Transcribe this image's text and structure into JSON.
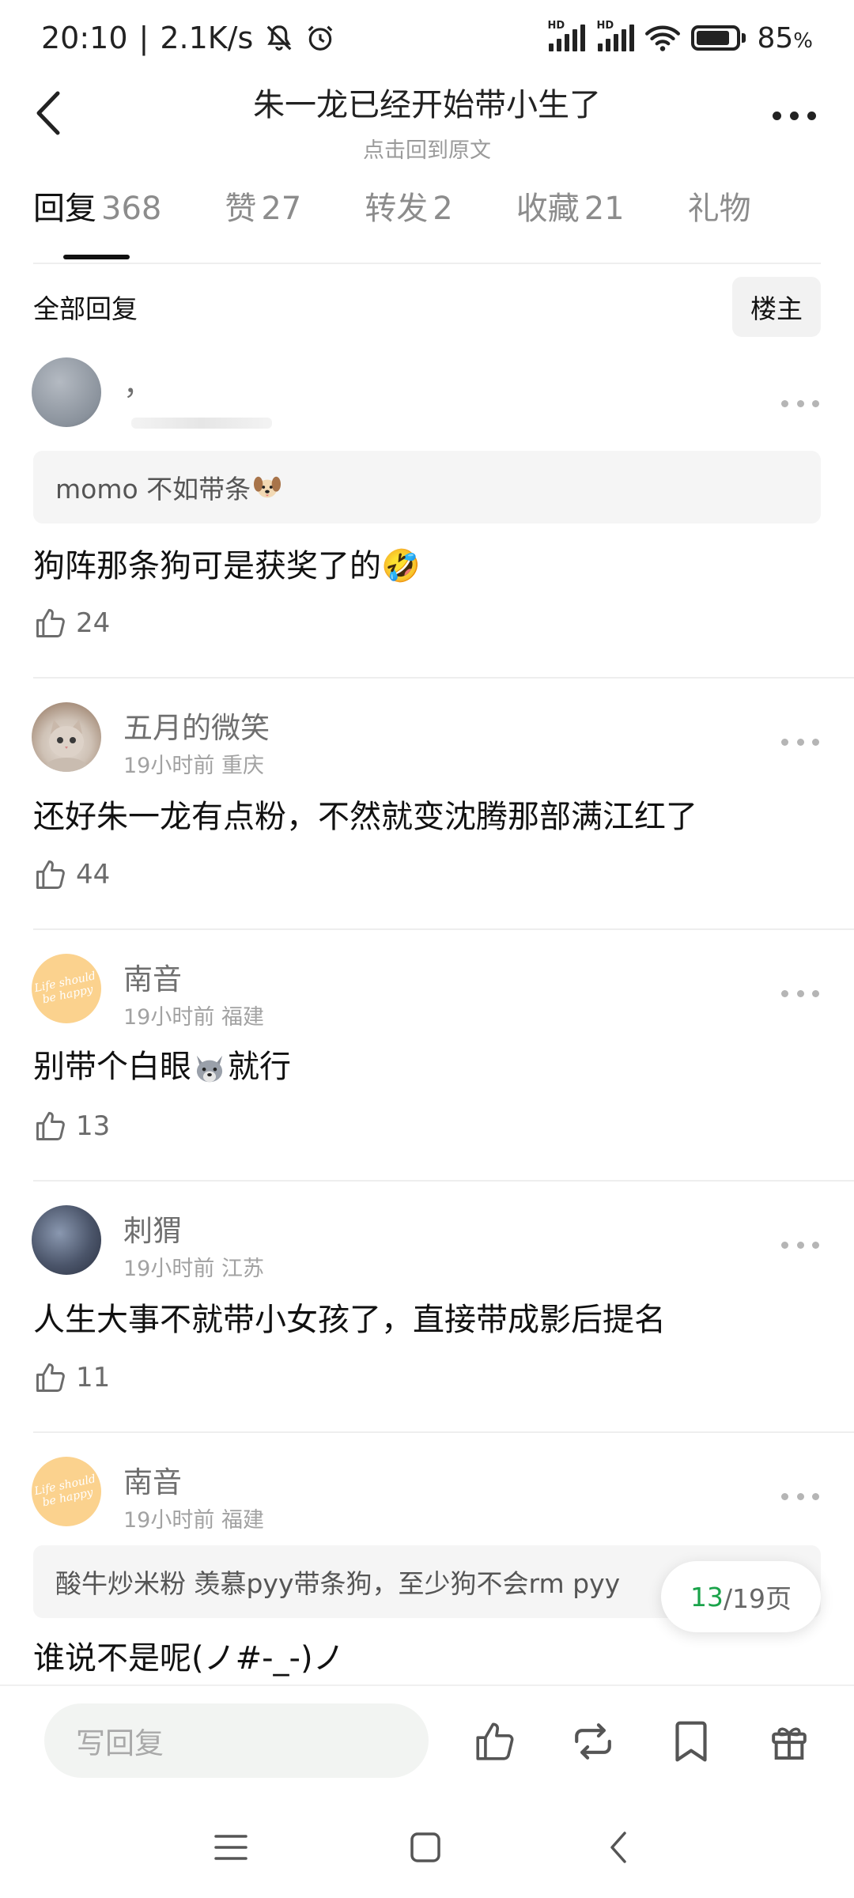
{
  "status": {
    "time": "20:10",
    "speed": "2.1K/s",
    "battery": "85",
    "battery_unit": "%",
    "battery_level": 0.85,
    "hd1": "HD",
    "hd2": "HD"
  },
  "header": {
    "title": "朱一龙已经开始带小生了",
    "subtitle": "点击回到原文"
  },
  "tabs": [
    {
      "label": "回复",
      "count": "368"
    },
    {
      "label": "赞",
      "count": "27"
    },
    {
      "label": "转发",
      "count": "2"
    },
    {
      "label": "收藏",
      "count": "21"
    },
    {
      "label": "礼物",
      "count": ""
    }
  ],
  "filter": {
    "label": "全部回复",
    "owner_button": "楼主"
  },
  "comments": [
    {
      "username": "，",
      "meta": "",
      "quote": "momo 不如带条",
      "text": "狗阵那条狗可是获奖了的🤣",
      "likes": "24",
      "avatar": "gray"
    },
    {
      "username": "五月的微笑",
      "meta": "19小时前 重庆",
      "quote": "",
      "text": "还好朱一龙有点粉，不然就变沈腾那部满江红了",
      "likes": "44",
      "avatar": "cat"
    },
    {
      "username": "南音",
      "meta": "19小时前 福建",
      "quote": "",
      "text_before": "别带个白眼",
      "text_after": "就行",
      "likes": "13",
      "avatar": "orange",
      "avatar_text": "Life should be happy"
    },
    {
      "username": "刺猬",
      "meta": "19小时前 江苏",
      "quote": "",
      "text": "人生大事不就带小女孩了，直接带成影后提名",
      "likes": "11",
      "avatar": "dark"
    },
    {
      "username": "南音",
      "meta": "19小时前 福建",
      "quote": "酸牛炒米粉 羡慕pyy带条狗，至少狗不会rm pyy",
      "text": "谁说不是呢(ノ#-_-)ノ",
      "likes": "",
      "avatar": "orange",
      "avatar_text": "Life should be happy"
    }
  ],
  "pagination": {
    "current": "13",
    "total": "/19页"
  },
  "bottom": {
    "reply_placeholder": "写回复"
  },
  "colors": {
    "accent_green": "#1aa34a",
    "text_primary": "#111111",
    "text_secondary": "#8c8c8c"
  },
  "icons": [
    "back-arrow-icon",
    "more-icon",
    "thumbs-up-icon",
    "repost-icon",
    "bookmark-icon",
    "gift-icon",
    "menu-icon",
    "home-icon",
    "back-icon"
  ]
}
